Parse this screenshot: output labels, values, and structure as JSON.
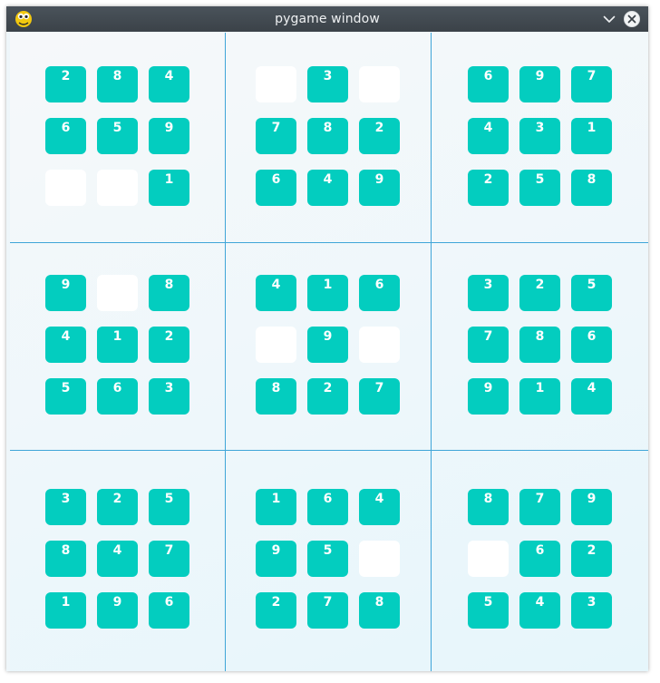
{
  "window": {
    "title": "pygame window",
    "icon": "pygame-snake-icon",
    "buttons": [
      "chevron-down-icon",
      "close-icon"
    ]
  },
  "colors": {
    "tile": "#03cdbf",
    "tile_empty": "#ffffff",
    "grid_line": "#3fa5d8",
    "titlebar": "#40474e"
  },
  "board": {
    "boxes": [
      [
        "2",
        "8",
        "4",
        "6",
        "5",
        "9",
        "",
        "",
        "1"
      ],
      [
        "",
        "3",
        "",
        "7",
        "8",
        "2",
        "6",
        "4",
        "9"
      ],
      [
        "6",
        "9",
        "7",
        "4",
        "3",
        "1",
        "2",
        "5",
        "8"
      ],
      [
        "9",
        "",
        "8",
        "4",
        "1",
        "2",
        "5",
        "6",
        "3"
      ],
      [
        "4",
        "1",
        "6",
        "",
        "9",
        "",
        "8",
        "2",
        "7"
      ],
      [
        "3",
        "2",
        "5",
        "7",
        "8",
        "6",
        "9",
        "1",
        "4"
      ],
      [
        "3",
        "2",
        "5",
        "8",
        "4",
        "7",
        "1",
        "9",
        "6"
      ],
      [
        "1",
        "6",
        "4",
        "9",
        "5",
        "",
        "2",
        "7",
        "8"
      ],
      [
        "8",
        "7",
        "9",
        "",
        "6",
        "2",
        "5",
        "4",
        "3"
      ]
    ]
  }
}
